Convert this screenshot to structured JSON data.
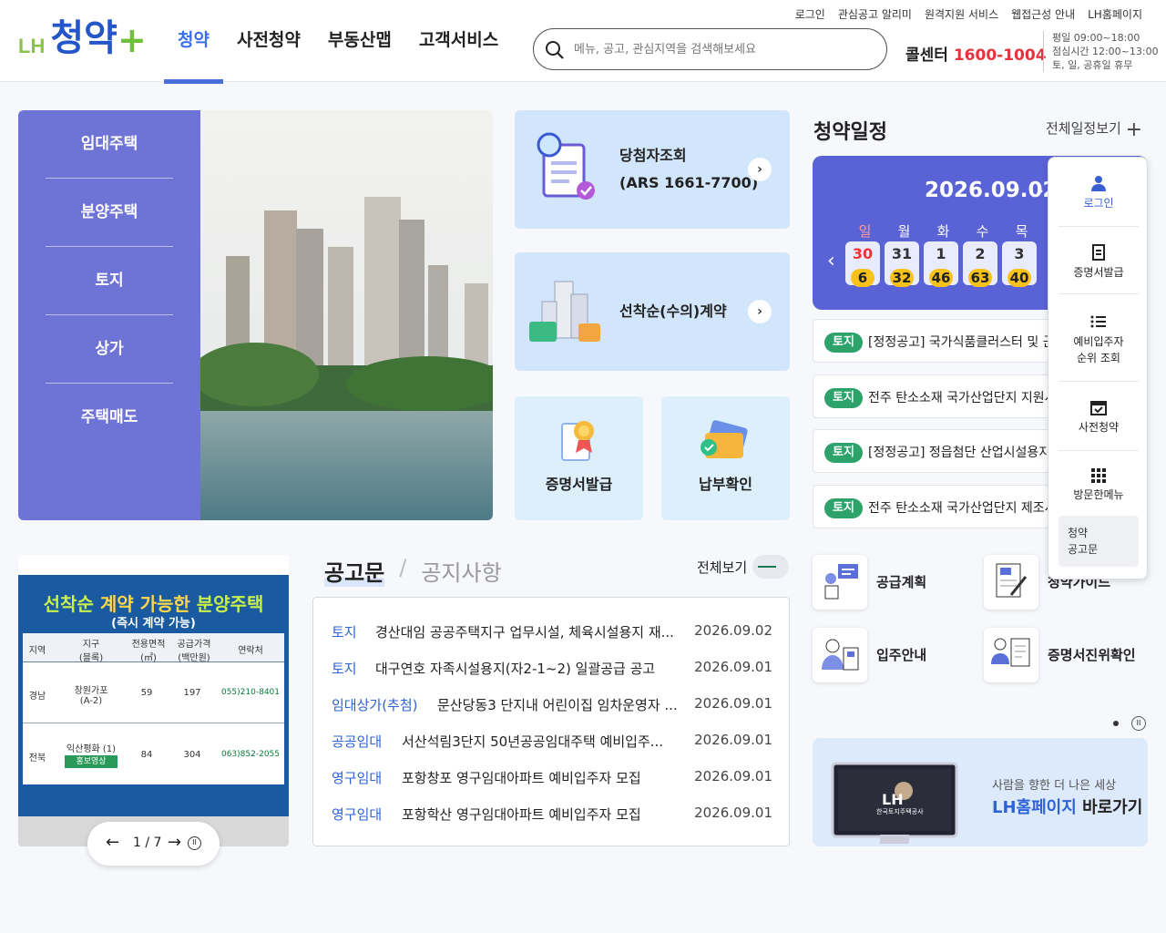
{
  "header": {
    "top_links": [
      "로그인",
      "관심공고 알리미",
      "원격지원 서비스",
      "웹접근성 안내",
      "LH홈페이지"
    ],
    "logo_prefix": "LH",
    "logo_text": "청약",
    "logo_plus": "+",
    "nav": [
      "청약",
      "사전청약",
      "부동산맵",
      "고객서비스"
    ],
    "search_placeholder": "메뉴, 공고, 관심지역을 검색해보세요",
    "call_label": "콜센터",
    "call_number": "1600-1004",
    "hours": [
      "평일 09:00~18:00",
      "점심시간 12:00~13:00",
      "토, 일, 공휴일 휴무"
    ]
  },
  "left_menu": [
    "임대주택",
    "분양주택",
    "토지",
    "상가",
    "주택매도"
  ],
  "quick": {
    "winner": {
      "title": "당첨자조회",
      "sub": "(ARS 1661-7700)"
    },
    "firstcome": "선착순(수의)계약",
    "certificate": "증명서발급",
    "payment": "납부확인"
  },
  "schedule": {
    "title": "청약일정",
    "all_link": "전체일정보기",
    "date": "2026.09.02",
    "dows": [
      "일",
      "월",
      "화",
      "수",
      "목"
    ],
    "days": [
      {
        "day": "30",
        "count": "6"
      },
      {
        "day": "31",
        "count": "32"
      },
      {
        "day": "1",
        "count": "46"
      },
      {
        "day": "2",
        "count": "63"
      },
      {
        "day": "3",
        "count": "40"
      }
    ],
    "items": [
      {
        "tag": "토지",
        "text": "[정정공고] 국가식품클러스터 및 군산"
      },
      {
        "tag": "토지",
        "text": "전주 탄소소재 국가산업단지 지원시설"
      },
      {
        "tag": "토지",
        "text": "[정정공고] 정읍첨단 산업시설용지 공급"
      },
      {
        "tag": "토지",
        "text": "전주 탄소소재 국가산업단지 제조시설"
      }
    ]
  },
  "quick_menu": [
    {
      "label": "로그인",
      "icon": "user-icon"
    },
    {
      "label": "증명서발급",
      "icon": "document-icon"
    },
    {
      "label": "예비입주자\n순위 조회",
      "icon": "list-icon"
    },
    {
      "label": "사전청약",
      "icon": "calendar-check-icon"
    },
    {
      "label": "방문한메뉴",
      "icon": "grid-icon"
    }
  ],
  "recent_menu": [
    "청약",
    "공고문"
  ],
  "promo": {
    "headline_a": "선착순",
    "headline_b": "계약 가능한",
    "headline_c": "분양주택",
    "sub": "(즉시 계약 가능)",
    "cols": [
      "지역",
      "지구\n(블록)",
      "전용면적\n(㎡)",
      "공급가격\n(백만원)",
      "연락처"
    ],
    "rows": [
      [
        "경남",
        "창원가포\n(A-2)",
        "59",
        "197",
        "055)210-8401"
      ],
      [
        "전북",
        "익산평화 (1)",
        "84",
        "304",
        "063)852-2055"
      ]
    ],
    "video_badge": "홍보영상",
    "pager": "1 / 7"
  },
  "notice": {
    "tab_active": "공고문",
    "tab_inactive": "공지사항",
    "view_all": "전체보기",
    "rows": [
      {
        "cat": "토지",
        "title": "경산대임 공공주택지구 업무시설, 체육시설용지 재...",
        "date": "2026.09.02"
      },
      {
        "cat": "토지",
        "title": "대구연호 자족시설용지(자2-1~2) 일괄공급 공고",
        "date": "2026.09.01"
      },
      {
        "cat": "임대상가(추첨)",
        "title": "문산당동3 단지내 어린이집 임차운영자 ...",
        "date": "2026.09.01"
      },
      {
        "cat": "공공임대",
        "title": "서산석림3단지 50년공공임대주택 예비입주...",
        "date": "2026.09.01"
      },
      {
        "cat": "영구임대",
        "title": "포항창포 영구임대아파트 예비입주자 모집",
        "date": "2026.09.01"
      },
      {
        "cat": "영구임대",
        "title": "포항학산 영구임대아파트 예비입주자 모집",
        "date": "2026.09.01"
      }
    ]
  },
  "services": [
    "공급계획",
    "청약가이드",
    "입주안내",
    "증명서진위확인"
  ],
  "banner": {
    "sub": "사람을 향한 더 나은 세상",
    "title_a": "LH홈페이지",
    "title_b": "바로가기",
    "screen_logo": "LH",
    "screen_text": "한국토지주택공사"
  }
}
